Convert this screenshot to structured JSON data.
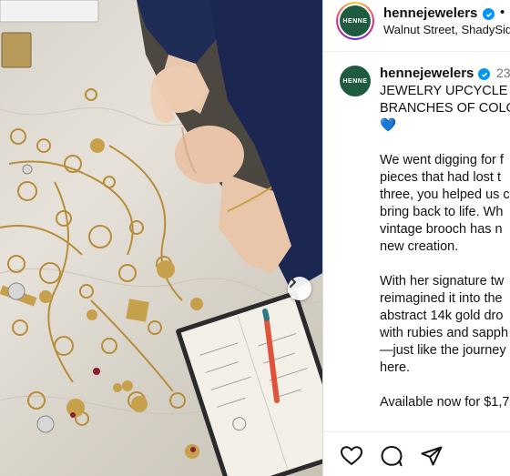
{
  "photo": {
    "description_icon": "jewelry-photo",
    "next_icon": "chevron-right-icon"
  },
  "header": {
    "avatar_text": "HENNE",
    "username": "hennejewelers",
    "separator": "•",
    "location": "Walnut Street, ShadySide"
  },
  "post": {
    "avatar_text": "HENNE",
    "username": "hennejewelers",
    "time": "23",
    "heading_lines": [
      "JEWELRY UPCYCLE I",
      "BRANCHES OF COLO"
    ],
    "heart": "💙",
    "para1": [
      "We went digging for f",
      "pieces that had lost t",
      "three, you helped us c",
      "bring back to life. Wh",
      "vintage brooch has n",
      "new creation."
    ],
    "para2": [
      "With her signature tw",
      "reimagined it into the",
      "abstract 14k gold dro",
      "with rubies and sapph",
      "—just like the journey",
      "here."
    ],
    "para3": [
      "Available now for $1,7"
    ]
  },
  "actions": {
    "like_icon": "heart-icon",
    "comment_icon": "comment-icon",
    "share_icon": "share-icon"
  },
  "colors": {
    "brand_green": "#1e5b3f",
    "verified_blue": "#0095f6"
  }
}
